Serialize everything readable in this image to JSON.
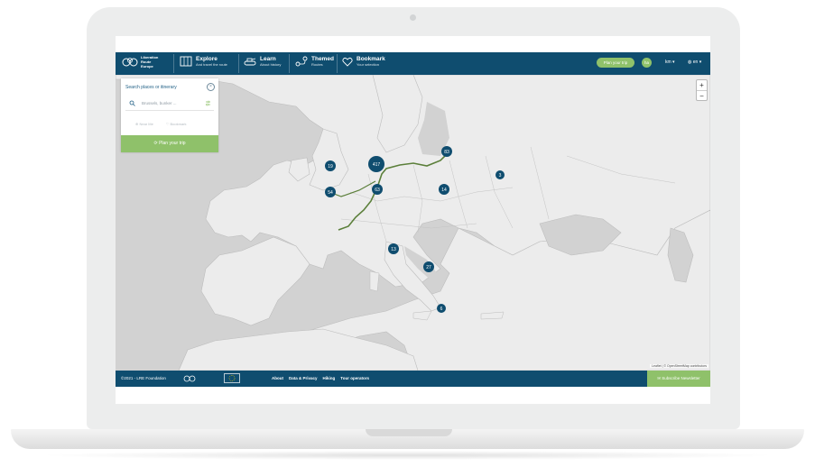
{
  "brand": {
    "name": "Liberation Route Europe"
  },
  "nav": [
    {
      "title": "Explore",
      "subtitle": "And travel the route"
    },
    {
      "title": "Learn",
      "subtitle": "About history"
    },
    {
      "title": "Themed",
      "subtitle": "Routes"
    },
    {
      "title": "Bookmark",
      "subtitle": "Your selection"
    }
  ],
  "header": {
    "plan_trip": "Plan your trip",
    "avatar": "ha",
    "unit": "km",
    "language": "en"
  },
  "panel": {
    "label": "Search places or itinerary",
    "placeholder": "Brussels, bunker ...",
    "options": [
      "Near Me",
      "Bookmark"
    ],
    "plan": "Plan your trip"
  },
  "clusters": [
    "417",
    "83",
    "19",
    "63",
    "14",
    "54",
    "3",
    "13",
    "27",
    "6"
  ],
  "zoom": {
    "in": "+",
    "out": "−"
  },
  "attribution": "Leaflet | © OpenStreetMap contributors",
  "footer": {
    "copyright": "©2021 - LRE Foundation",
    "links": [
      "About",
      "Data & Privacy",
      "Hiking",
      "Tour operators"
    ],
    "subscribe": "Subscribe Newsletter"
  },
  "colors": {
    "primary": "#0f4d6f",
    "accent": "#8fc16a",
    "map_land": "#ececec",
    "map_sea": "#d2d2d2",
    "route": "#5b7f3a"
  }
}
